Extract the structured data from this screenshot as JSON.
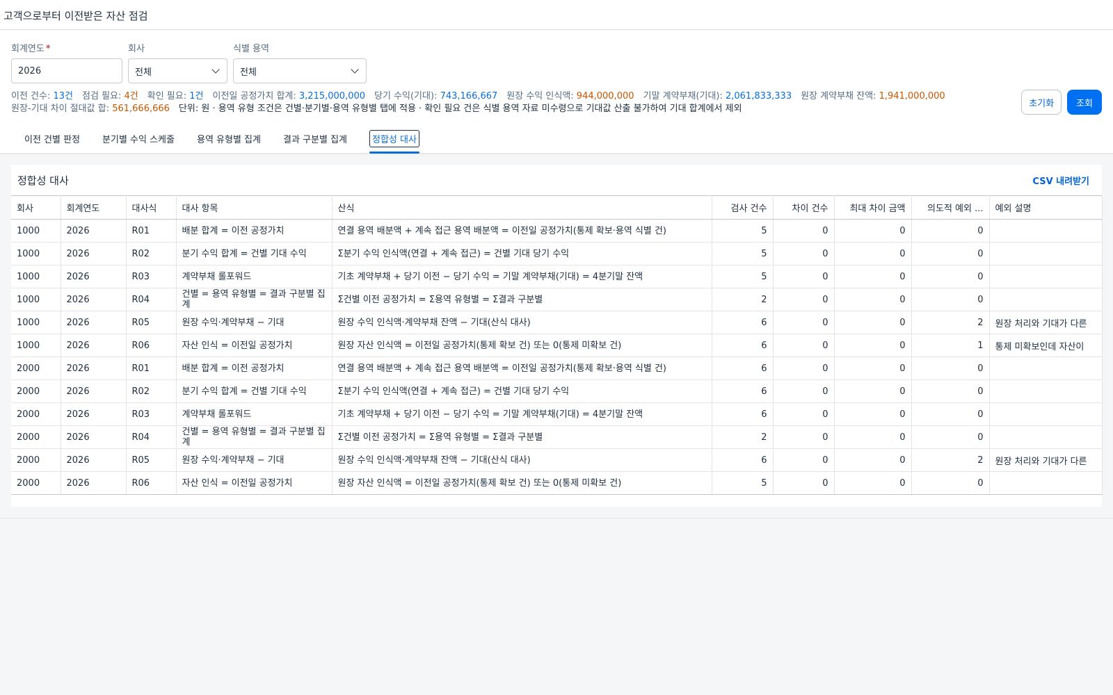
{
  "app": {
    "title": "고객으로부터 이전받은 자산 점검"
  },
  "filters": {
    "year": {
      "label": "회계연도",
      "required_mark": "*",
      "value": "2026"
    },
    "company": {
      "label": "회사",
      "value": "전체"
    },
    "service": {
      "label": "식별 용역",
      "value": "전체"
    },
    "reset_label": "초기화",
    "search_label": "조회"
  },
  "summary": {
    "items": [
      {
        "label": "이전 건수: ",
        "value": "13건",
        "color": "#0a6ed1"
      },
      {
        "label": "점검 필요: ",
        "value": "4건",
        "color": "#c35500"
      },
      {
        "label": "확인 필요: ",
        "value": "1건",
        "color": "#0a6ed1"
      },
      {
        "label": "이전일 공정가치 합계: ",
        "value": "3,215,000,000",
        "color": "#0a6ed1"
      },
      {
        "label": "당기 수익(기대): ",
        "value": "743,166,667",
        "color": "#0a6ed1"
      },
      {
        "label": "원장 수익 인식액: ",
        "value": "944,000,000",
        "color": "#c35500"
      },
      {
        "label": "기말 계약부채(기대): ",
        "value": "2,061,833,333",
        "color": "#0a6ed1"
      },
      {
        "label": "원장 계약부채 잔액: ",
        "value": "1,941,000,000",
        "color": "#c35500"
      },
      {
        "label": "원장-기대 차이 절대값 합: ",
        "value": "561,666,666",
        "color": "#c35500"
      }
    ],
    "unit_note": "단위: 원 · 용역 유형 조건은 건별·분기별·용역 유형별 탭에 적용 · 확인 필요 건은 식별 용역 자료 미수령으로 기대값 산출 불가하여 기대 합계에서 제외"
  },
  "tabs": [
    {
      "label": "이전 건별 판정"
    },
    {
      "label": "분기별 수익 스케줄"
    },
    {
      "label": "용역 유형별 집계"
    },
    {
      "label": "결과 구분별 집계"
    },
    {
      "label": "정합성 대사",
      "active": true
    }
  ],
  "panel": {
    "title": "정합성 대사",
    "csv_label": "CSV 내려받기",
    "columns": [
      "회사",
      "회계연도",
      "대사식",
      "대사 항목",
      "산식",
      "검사 건수",
      "차이 건수",
      "최대 차이 금액",
      "의도적 예외 ...",
      "예외 설명"
    ],
    "rows": [
      [
        "1000",
        "2026",
        "R01",
        "배분 합계 = 이전 공정가치",
        "연결 용역 배분액 + 계속 접근 용역 배분액 = 이전일 공정가치(통제 확보·용역 식별 건)",
        "5",
        "0",
        "0",
        "0",
        ""
      ],
      [
        "1000",
        "2026",
        "R02",
        "분기 수익 합계 = 건별 기대 수익",
        "Σ분기 수익 인식액(연결 + 계속 접근) = 건별 기대 당기 수익",
        "5",
        "0",
        "0",
        "0",
        ""
      ],
      [
        "1000",
        "2026",
        "R03",
        "계약부채 롤포워드",
        "기초 계약부채 + 당기 이전 − 당기 수익 = 기말 계약부채(기대) = 4분기말 잔액",
        "5",
        "0",
        "0",
        "0",
        ""
      ],
      [
        "1000",
        "2026",
        "R04",
        "건별 = 용역 유형별 = 결과 구분별 집계",
        "Σ건별 이전 공정가치 = Σ용역 유형별 = Σ결과 구분별",
        "2",
        "0",
        "0",
        "0",
        ""
      ],
      [
        "1000",
        "2026",
        "R05",
        "원장 수익·계약부채 − 기대",
        "원장 수익 인식액·계약부채 잔액 − 기대(산식 대사)",
        "6",
        "0",
        "0",
        "2",
        "원장 처리와 기대가 다른"
      ],
      [
        "1000",
        "2026",
        "R06",
        "자산 인식 = 이전일 공정가치",
        "원장 자산 인식액 = 이전일 공정가치(통제 확보 건) 또는 0(통제 미확보 건)",
        "6",
        "0",
        "0",
        "1",
        "통제 미확보인데 자산이"
      ],
      [
        "2000",
        "2026",
        "R01",
        "배분 합계 = 이전 공정가치",
        "연결 용역 배분액 + 계속 접근 용역 배분액 = 이전일 공정가치(통제 확보·용역 식별 건)",
        "6",
        "0",
        "0",
        "0",
        ""
      ],
      [
        "2000",
        "2026",
        "R02",
        "분기 수익 합계 = 건별 기대 수익",
        "Σ분기 수익 인식액(연결 + 계속 접근) = 건별 기대 당기 수익",
        "6",
        "0",
        "0",
        "0",
        ""
      ],
      [
        "2000",
        "2026",
        "R03",
        "계약부채 롤포워드",
        "기초 계약부채 + 당기 이전 − 당기 수익 = 기말 계약부채(기대) = 4분기말 잔액",
        "6",
        "0",
        "0",
        "0",
        ""
      ],
      [
        "2000",
        "2026",
        "R04",
        "건별 = 용역 유형별 = 결과 구분별 집계",
        "Σ건별 이전 공정가치 = Σ용역 유형별 = Σ결과 구분별",
        "2",
        "0",
        "0",
        "0",
        ""
      ],
      [
        "2000",
        "2026",
        "R05",
        "원장 수익·계약부채 − 기대",
        "원장 수익 인식액·계약부채 잔액 − 기대(산식 대사)",
        "6",
        "0",
        "0",
        "2",
        "원장 처리와 기대가 다른"
      ],
      [
        "2000",
        "2026",
        "R06",
        "자산 인식 = 이전일 공정가치",
        "원장 자산 인식액 = 이전일 공정가치(통제 확보 건) 또는 0(통제 미확보 건)",
        "5",
        "0",
        "0",
        "0",
        ""
      ]
    ]
  }
}
